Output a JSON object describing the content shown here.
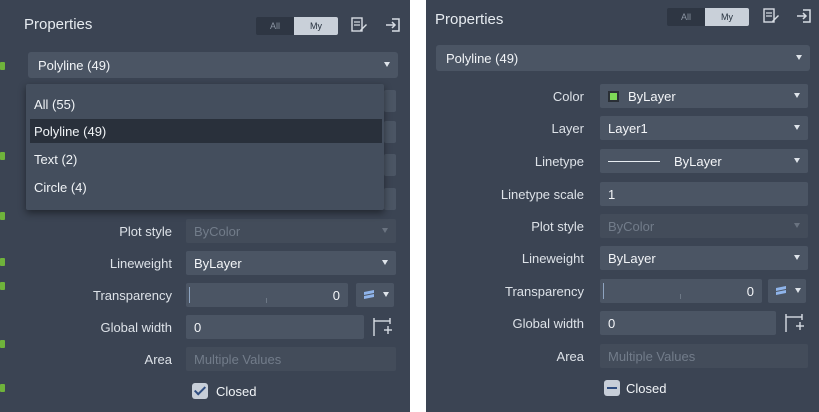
{
  "colors": {
    "panel_bg": "#3b4453",
    "control_bg": "#4b5564",
    "selected_row_bg": "#29303b",
    "swatch_green": "#7ed957",
    "accent_blue": "#3b6ed8"
  },
  "left": {
    "title": "Properties",
    "filter_all": "All",
    "filter_my": "My",
    "selection_dropdown": "Polyline (49)",
    "popup_items": [
      "All (55)",
      "Polyline (49)",
      "Text (2)",
      "Circle (4)"
    ],
    "popup_selected_index": 1,
    "labels": {
      "plot_style": "Plot style",
      "lineweight": "Lineweight",
      "transparency": "Transparency",
      "global_width": "Global width",
      "area": "Area"
    },
    "values": {
      "plot_style": "ByColor",
      "lineweight": "ByLayer",
      "transparency": "0",
      "global_width": "0",
      "area": "Multiple Values"
    },
    "closed_label": "Closed",
    "closed_state": "checked"
  },
  "right": {
    "title": "Properties",
    "filter_all": "All",
    "filter_my": "My",
    "selection_dropdown": "Polyline (49)",
    "labels": {
      "color": "Color",
      "layer": "Layer",
      "linetype": "Linetype",
      "linetype_scale": "Linetype scale",
      "plot_style": "Plot style",
      "lineweight": "Lineweight",
      "transparency": "Transparency",
      "global_width": "Global width",
      "area": "Area"
    },
    "values": {
      "color": "ByLayer",
      "layer": "Layer1",
      "linetype": "ByLayer",
      "linetype_scale": "1",
      "plot_style": "ByColor",
      "lineweight": "ByLayer",
      "transparency": "0",
      "global_width": "0",
      "area": "Multiple Values"
    },
    "closed_label": "Closed",
    "closed_state": "mixed"
  }
}
